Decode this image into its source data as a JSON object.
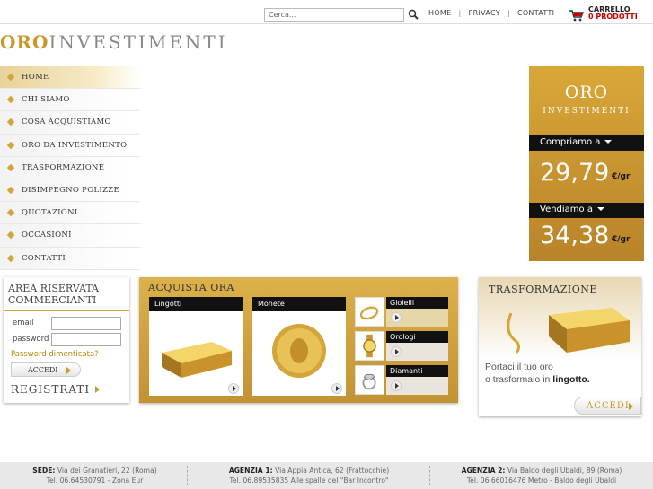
{
  "header": {
    "search_placeholder": "Cerca...",
    "nav": [
      "HOME",
      "PRIVACY",
      "CONTATTI"
    ],
    "cart_label": "CARRELLO",
    "cart_count": "0 PRODOTTI"
  },
  "logo": {
    "part1": "ORO",
    "part2": "INVESTIMENTI"
  },
  "sidebar": {
    "items": [
      {
        "label": "HOME",
        "active": true
      },
      {
        "label": "CHI SIAMO"
      },
      {
        "label": "COSA ACQUISTIAMO"
      },
      {
        "label": "ORO DA INVESTIMENTO"
      },
      {
        "label": "TRASFORMAZIONE"
      },
      {
        "label": "DISIMPEGNO POLIZZE"
      },
      {
        "label": "QUOTAZIONI"
      },
      {
        "label": "OCCASIONI"
      },
      {
        "label": "CONTATTI"
      }
    ]
  },
  "prices": {
    "logo_oro": "ORO",
    "logo_inv": "INVESTIMENTI",
    "buy_label": "Compriamo a",
    "buy_price": "29,79",
    "sell_label": "Vendiamo a",
    "sell_price": "34,38",
    "unit": "€/gr"
  },
  "area": {
    "title_line1": "AREA RISERVATA",
    "title_line2": "COMMERCIANTI",
    "email_label": "email",
    "password_label": "password",
    "forgot": "Password dimenticata?",
    "login_button": "ACCEDI",
    "register": "REGISTRATI"
  },
  "shop": {
    "title": "ACQUISTA ORA",
    "large": [
      "Lingotti",
      "Monete"
    ],
    "small": [
      "Gioielli",
      "Orologi",
      "Diamanti"
    ]
  },
  "transform": {
    "title": "TRASFORMAZIONE",
    "text_line1": "Portaci il tuo oro",
    "text_line2_a": "o trasformalo in ",
    "text_line2_b": "lingotto.",
    "button": "ACCEDI"
  },
  "footer": [
    {
      "name": "SEDE:",
      "addr": "Via dei Granatieri, 22 (Roma)",
      "tel": "Tel. 06.64530791 - Zona Eur"
    },
    {
      "name": "AGENZIA 1:",
      "addr": "Via Appia Antica, 62 (Frattocchie)",
      "tel": "Tel. 06.89535835 Alle spalle del \"Bar Incontro\""
    },
    {
      "name": "AGENZIA 2:",
      "addr": "Via Baldo degli Ubaldi, 89 (Roma)",
      "tel": "Tel. 06.66016476 Metro - Baldo degli Ubaldi"
    }
  ],
  "colors": {
    "gold": "#c9982a",
    "dark": "#111111",
    "cart_red": "#cc0000"
  }
}
